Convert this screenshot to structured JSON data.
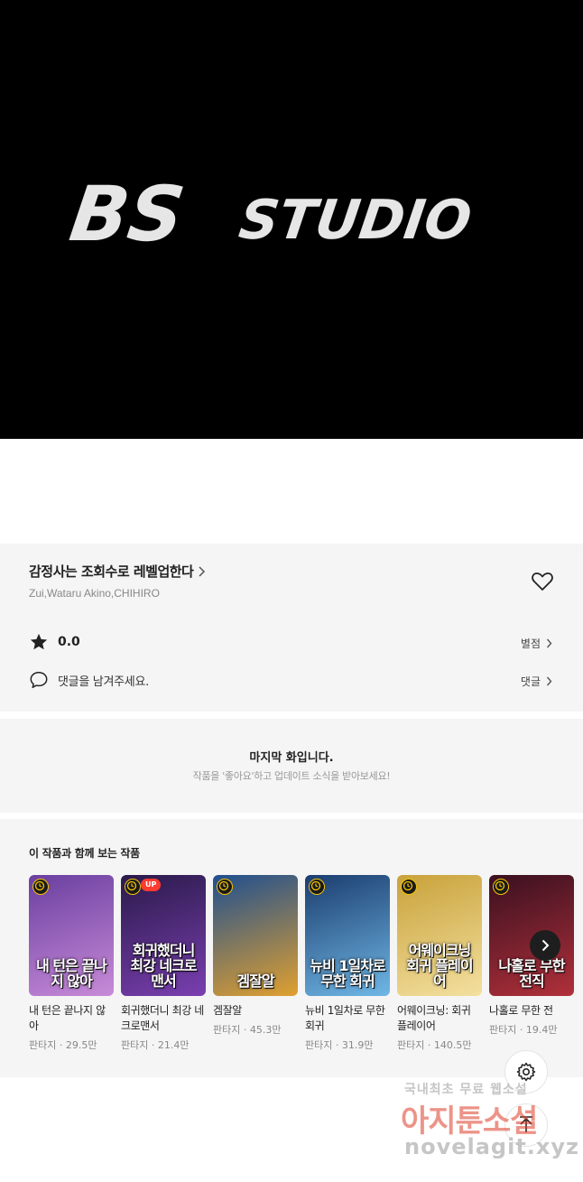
{
  "banner": {
    "logo_bs": "BS",
    "logo_studio": "STUDIO"
  },
  "series": {
    "title": "감정사는 조회수로 레벨업한다",
    "authors": "Zui,Wataru Akino,CHIHIRO",
    "rating": "0.0",
    "rating_link": "별점",
    "comment_prompt": "댓글을 남겨주세요.",
    "comment_link": "댓글"
  },
  "last_episode": {
    "title": "마지막 화입니다.",
    "subtitle": "작품을 '좋아요'하고 업데이트 소식을 받아보세요!"
  },
  "recommendations": {
    "title": "이 작품과 함께 보는 작품",
    "items": [
      {
        "title": "내 턴은 끝나지 않아",
        "meta": "판타지 · 29.5만",
        "cover_text": "내 턴은 끝나지 않아",
        "badge": "",
        "colors": [
          "#6a3fa0",
          "#c88bd8"
        ]
      },
      {
        "title": "회귀했더니 최강 네크로맨서",
        "meta": "판타지 · 21.4만",
        "cover_text": "회귀했더니 최강 네크로맨서",
        "badge": "UP",
        "colors": [
          "#2a1a4a",
          "#7a3fb0"
        ]
      },
      {
        "title": "겜잘알",
        "meta": "판타지 · 45.3만",
        "cover_text": "겜잘알",
        "badge": "",
        "colors": [
          "#1f4f8f",
          "#e0a030"
        ]
      },
      {
        "title": "뉴비 1일차로 무한 회귀",
        "meta": "판타지 · 31.9만",
        "cover_text": "뉴비 1일차로 무한 회귀",
        "badge": "",
        "colors": [
          "#1b3d6e",
          "#6fb7e6"
        ]
      },
      {
        "title": "어웨이크닝: 회귀 플레이어",
        "meta": "판타지 · 140.5만",
        "cover_text": "어웨이크닝 회귀 플레이어",
        "badge": "",
        "colors": [
          "#c9a23a",
          "#f3e0a0"
        ]
      },
      {
        "title": "나홀로 무한 전",
        "meta": "판타지 · 19.4만",
        "cover_text": "나홀로 무한전직",
        "badge": "",
        "colors": [
          "#3a1020",
          "#b0303a"
        ]
      }
    ]
  },
  "icons": {
    "heart": "heart-icon",
    "star": "star-icon",
    "comment": "comment-icon",
    "next": "chevron-right-icon",
    "settings": "gear-icon",
    "top": "arrow-up-icon"
  },
  "watermark": {
    "line1": "국내최초 무료 웹소설",
    "line2": "아지툰소설",
    "line3": "novelagit.xyz"
  }
}
